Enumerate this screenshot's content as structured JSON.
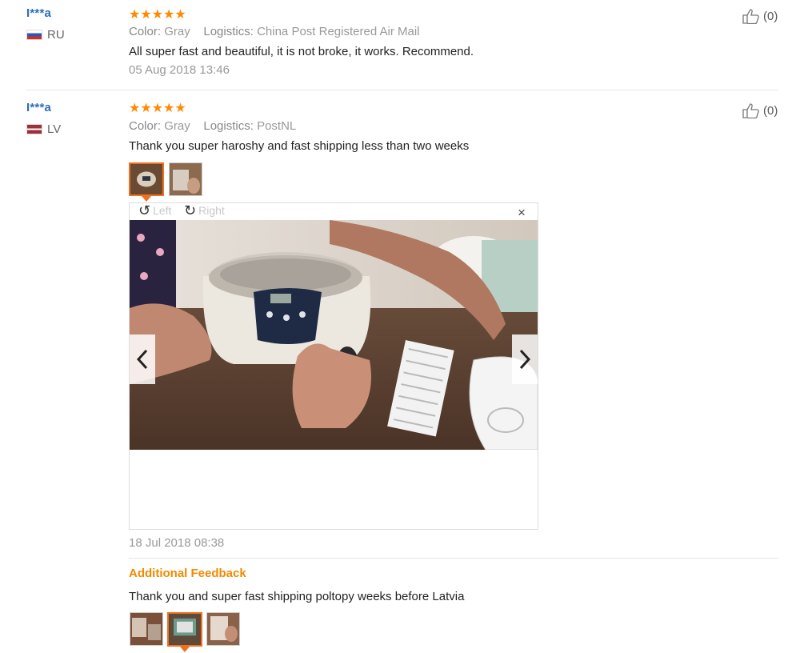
{
  "reviews": [
    {
      "user": "I***a",
      "country": "RU",
      "stars": "★★★★★",
      "color_label": "Color:",
      "color_value": "Gray",
      "logistics_label": "Logistics:",
      "logistics_value": "China Post Registered Air Mail",
      "text": "All super fast and beautiful, it is not broke, it works. Recommend.",
      "date": "05 Aug 2018 13:46",
      "helpful": "(0)"
    },
    {
      "user": "I***a",
      "country": "LV",
      "stars": "★★★★★",
      "color_label": "Color:",
      "color_value": "Gray",
      "logistics_label": "Logistics:",
      "logistics_value": "PostNL",
      "text": "Thank you super haroshy and fast shipping less than two weeks",
      "date": "18 Jul 2018 08:38",
      "helpful": "(0)"
    }
  ],
  "viewer": {
    "rotate_left": "Left",
    "rotate_right": "Right",
    "close": "×"
  },
  "additional": {
    "title": "Additional Feedback",
    "text": "Thank you and super fast shipping poltopy weeks before Latvia"
  },
  "colors": {
    "username": "#2a6ebd",
    "stars": "#ff8a00",
    "accent": "#f0701d"
  }
}
